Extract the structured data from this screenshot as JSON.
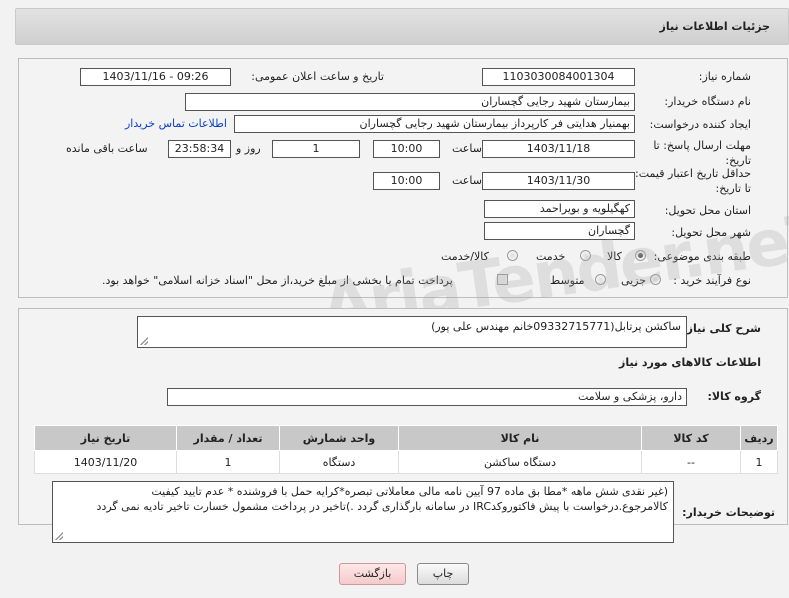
{
  "header": {
    "title": "جزئیات اطلاعات نیاز"
  },
  "form": {
    "need_number_label": "شماره نیاز:",
    "need_number": "1103030084001304",
    "announce_label": "تاریخ و ساعت اعلان عمومی:",
    "announce_value": "1403/11/16 - 09:26",
    "buyer_org_label": "نام دستگاه خریدار:",
    "buyer_org": "بیمارستان شهید رجایی گچساران",
    "requester_label": "ایجاد کننده درخواست:",
    "requester": "بهمنیار هدایتی فر کارپرداز بیمارستان شهید رجایی گچساران",
    "contact_link": "اطلاعات تماس خریدار",
    "deadline_label": "مهلت ارسال پاسخ: تا تاریخ:",
    "deadline_date": "1403/11/18",
    "time_label": "ساعت",
    "deadline_time": "10:00",
    "days_value": "1",
    "days_label": "روز و",
    "remaining_value": "23:58:34",
    "remaining_label": "ساعت باقی مانده",
    "validity_label": "حداقل تاریخ اعتبار قیمت: تا تاریخ:",
    "validity_date": "1403/11/30",
    "validity_time": "10:00",
    "province_label": "استان محل تحویل:",
    "province": "کهگیلویه و بویراحمد",
    "city_label": "شهر محل تحویل:",
    "city": "گچساران",
    "category_label": "طبقه بندی موضوعی:",
    "category_options": [
      "کالا",
      "خدمت",
      "کالا/خدمت"
    ],
    "purchase_type_label": "نوع فرآیند خرید :",
    "purchase_options": [
      "جزیی",
      "متوسط"
    ],
    "payment_note": "پرداخت تمام یا بخشی از مبلغ خرید،از محل \"اسناد خزانه اسلامی\" خواهد بود."
  },
  "description": {
    "label": "شرح کلی نیاز:",
    "value": "ساکشن پرتابل(09332715771خانم مهندس علی پور)"
  },
  "goods": {
    "section_title": "اطلاعات کالاهای مورد نیاز",
    "group_label": "گروه کالا:",
    "group_value": "دارو، پزشکی و سلامت",
    "columns": [
      "ردیف",
      "کد کالا",
      "نام کالا",
      "واحد شمارش",
      "تعداد / مقدار",
      "تاریخ نیاز"
    ],
    "rows": [
      [
        "1",
        "--",
        "دستگاه ساکشن",
        "دستگاه",
        "1",
        "1403/11/20"
      ]
    ]
  },
  "buyer_notes": {
    "label": "توضیحات خریدار:",
    "value": "(غیر نقدی شش ماهه *مطا بق ماده 97 آیین نامه مالی معاملاتی تبصره*کرایه حمل با فروشنده * عدم تایید کیفیت کالامرجوع.درخواست با پیش فاکتوروکدIRC در سامانه بارگذاری گردد .)تاخیر در پرداخت مشمول خسارت تاخیر تادیه نمی گردد"
  },
  "buttons": {
    "print": "چاپ",
    "back": "بازگشت"
  },
  "watermark": "AriaTender.neT"
}
